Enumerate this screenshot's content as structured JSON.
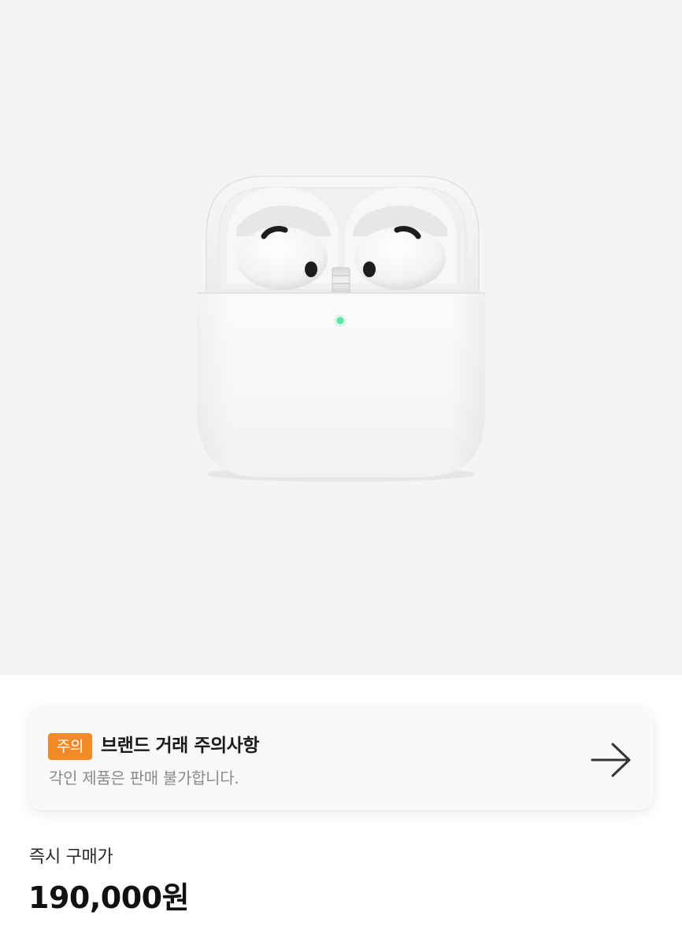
{
  "product": {
    "image_icon": "airpods-case-image"
  },
  "notice": {
    "badge": "주의",
    "title": "브랜드 거래 주의사항",
    "subtitle": "각인 제품은 판매 불가합니다.",
    "arrow_icon": "arrow-right-icon",
    "badge_color": "#f28a2a"
  },
  "price": {
    "label": "즉시 구매가",
    "value": "190,000원"
  }
}
